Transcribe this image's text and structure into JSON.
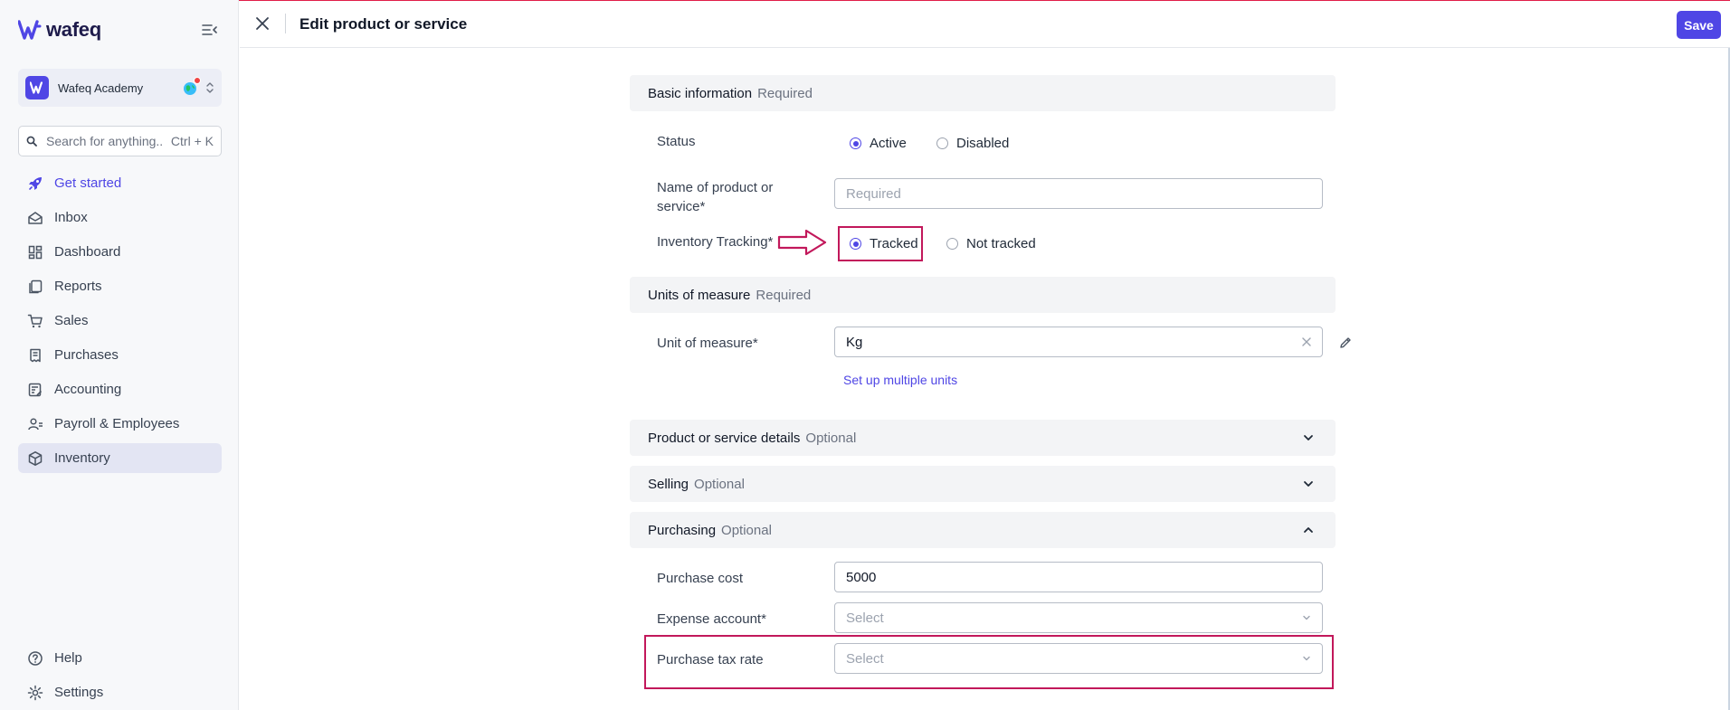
{
  "app": {
    "name": "wafeq"
  },
  "organization": {
    "name": "Wafeq Academy"
  },
  "search": {
    "placeholder": "Search for anything...",
    "shortcut": "Ctrl + K"
  },
  "nav": {
    "items": [
      {
        "label": "Get started",
        "icon": "rocket-icon"
      },
      {
        "label": "Inbox",
        "icon": "inbox-icon"
      },
      {
        "label": "Dashboard",
        "icon": "dashboard-icon"
      },
      {
        "label": "Reports",
        "icon": "reports-icon"
      },
      {
        "label": "Sales",
        "icon": "cart-icon"
      },
      {
        "label": "Purchases",
        "icon": "receipt-icon"
      },
      {
        "label": "Accounting",
        "icon": "ledger-icon"
      },
      {
        "label": "Payroll & Employees",
        "icon": "people-icon"
      },
      {
        "label": "Inventory",
        "icon": "box-icon"
      }
    ],
    "bottom": [
      {
        "label": "Help",
        "icon": "help-icon"
      },
      {
        "label": "Settings",
        "icon": "gear-icon"
      }
    ]
  },
  "header": {
    "title": "Edit product or service",
    "save_label": "Save"
  },
  "form": {
    "basic": {
      "title": "Basic information",
      "subtitle": "Required"
    },
    "status": {
      "label": "Status",
      "options": [
        "Active",
        "Disabled"
      ],
      "selected": "Active"
    },
    "name": {
      "label": "Name of product or service*",
      "placeholder": "Required",
      "value": ""
    },
    "tracking": {
      "label": "Inventory Tracking*",
      "options": [
        "Tracked",
        "Not tracked"
      ],
      "selected": "Tracked"
    },
    "units": {
      "title": "Units of measure",
      "subtitle": "Required"
    },
    "unit": {
      "label": "Unit of measure*",
      "value": "Kg"
    },
    "multiple_units_link": "Set up multiple units",
    "details": {
      "title": "Product or service details",
      "subtitle": "Optional"
    },
    "selling": {
      "title": "Selling",
      "subtitle": "Optional"
    },
    "purchasing": {
      "title": "Purchasing",
      "subtitle": "Optional"
    },
    "purchase_cost": {
      "label": "Purchase cost",
      "value": "5000"
    },
    "expense_account": {
      "label": "Expense account*",
      "placeholder": "Select"
    },
    "purchase_tax": {
      "label": "Purchase tax rate",
      "placeholder": "Select"
    }
  },
  "colors": {
    "accent": "#4f46e5",
    "highlight": "#c2185b"
  }
}
